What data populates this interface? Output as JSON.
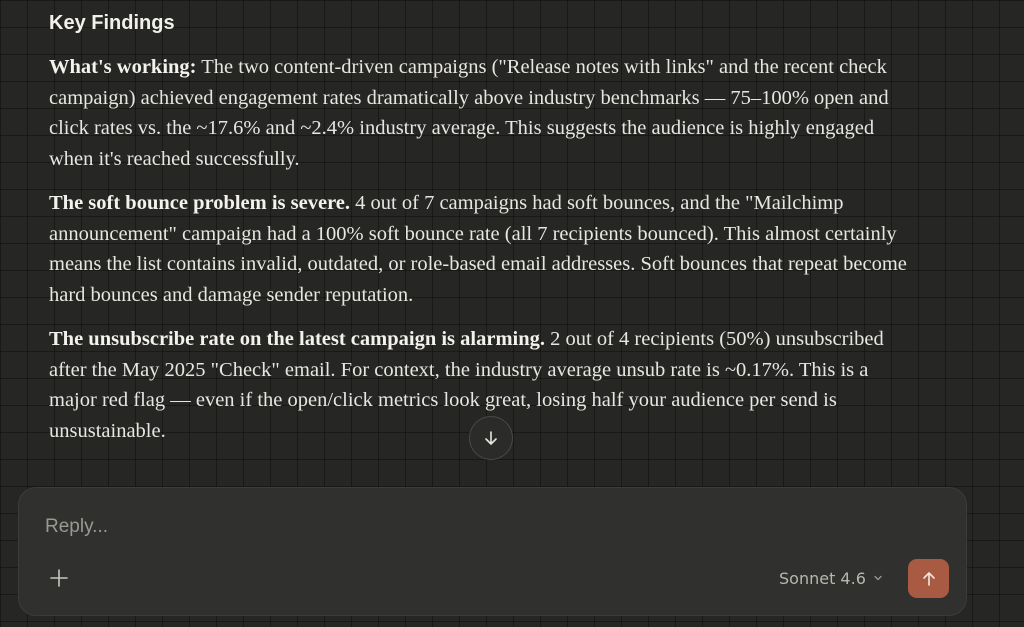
{
  "content": {
    "heading": "Key Findings",
    "paragraphs": [
      {
        "bold": "What's working:",
        "text": " The two content-driven campaigns (\"Release notes with links\" and the recent check campaign) achieved engagement rates dramatically above industry benchmarks — 75–100% open and click rates vs. the ~17.6% and ~2.4% industry average. This suggests the audience is highly engaged when it's reached successfully."
      },
      {
        "bold": "The soft bounce problem is severe.",
        "text": " 4 out of 7 campaigns had soft bounces, and the \"Mailchimp announcement\" campaign had a 100% soft bounce rate (all 7 recipients bounced). This almost certainly means the list contains invalid, outdated, or role-based email addresses. Soft bounces that repeat become hard bounces and damage sender reputation."
      },
      {
        "bold": "The unsubscribe rate on the latest campaign is alarming.",
        "text": " 2 out of 4 recipients (50%) unsubscribed after the May 2025 \"Check\" email. For context, the industry average unsub rate is ~0.17%. This is a major red flag — even if the open/click metrics look great, losing half your audience per send is unsustainable."
      }
    ]
  },
  "composer": {
    "placeholder": "Reply...",
    "model_label": "Sonnet 4.6"
  },
  "icons": {
    "scroll_down": "arrow-down-icon",
    "add": "plus-icon",
    "model_chevron": "chevron-down-icon",
    "send": "arrow-up-icon"
  },
  "colors": {
    "background": "#262624",
    "composer_bg": "#30302e",
    "send_button": "#a85a43",
    "text": "#e8e6e0"
  }
}
